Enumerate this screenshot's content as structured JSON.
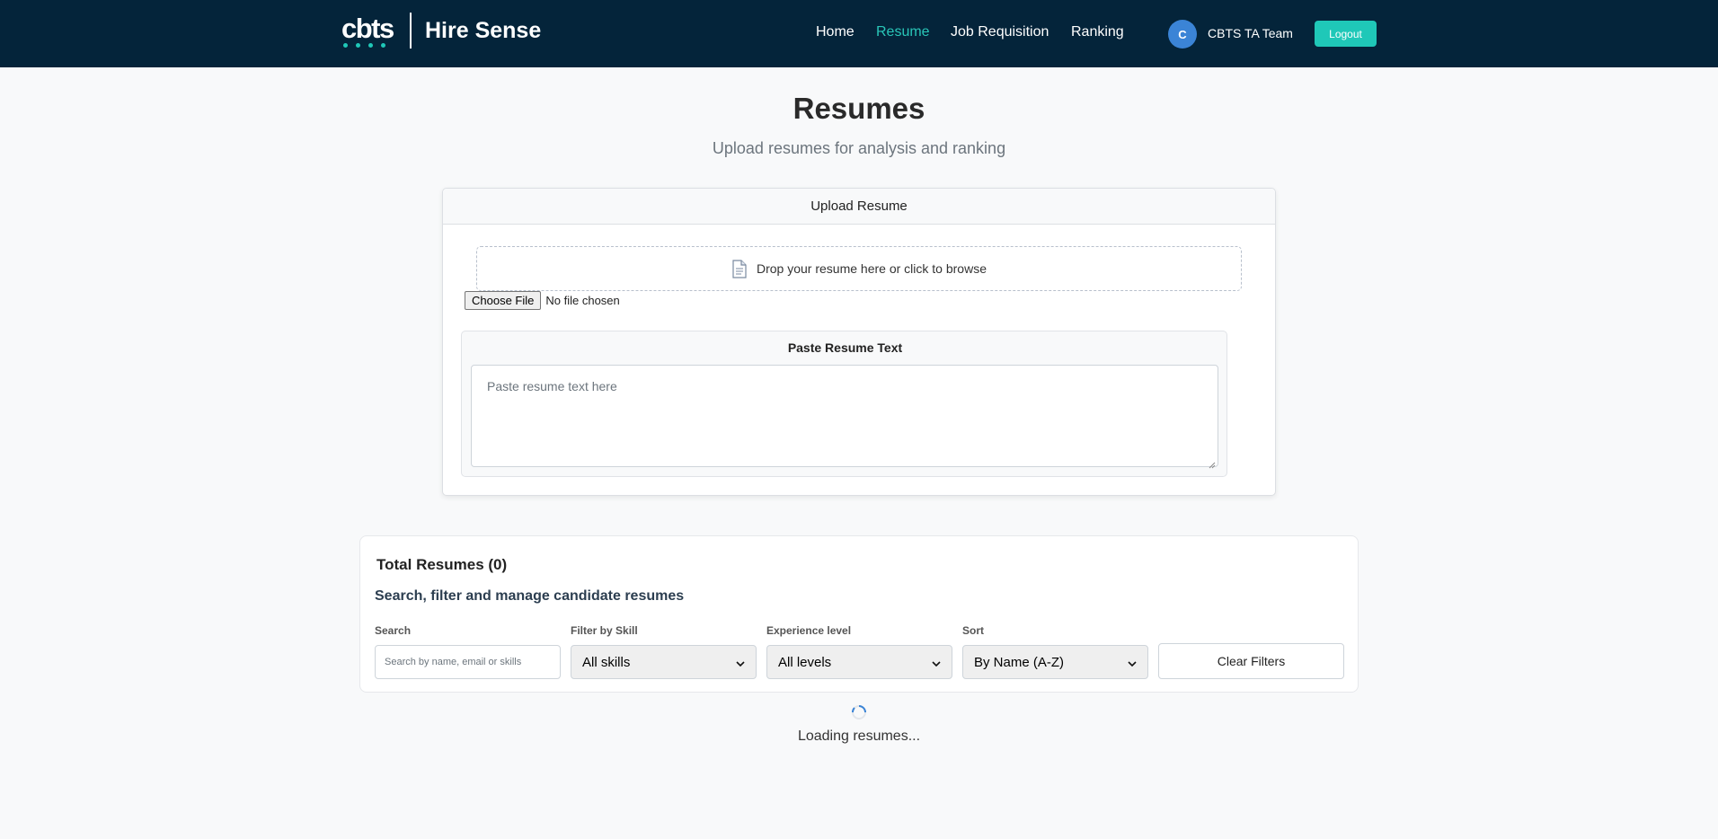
{
  "navbar": {
    "logo_text": "cbts",
    "app_title": "Hire Sense",
    "links": [
      {
        "label": "Home",
        "active": false
      },
      {
        "label": "Resume",
        "active": true
      },
      {
        "label": "Job Requisition",
        "active": false
      },
      {
        "label": "Ranking",
        "active": false
      }
    ],
    "user_initial": "C",
    "user_name": "CBTS TA Team",
    "logout_label": "Logout"
  },
  "header": {
    "title": "Resumes",
    "subtitle": "Upload resumes for analysis and ranking"
  },
  "upload": {
    "card_title": "Upload Resume",
    "dropzone_icon": "document-icon",
    "dropzone_text": "Drop your resume here or click to browse",
    "choose_file_label": "Choose File",
    "file_status": "No file chosen",
    "paste_title": "Paste Resume Text",
    "paste_placeholder": "Paste resume text here"
  },
  "resumes": {
    "total_title": "Total Resumes (0)",
    "manage_title": "Search, filter and manage candidate resumes",
    "search_label": "Search",
    "search_placeholder": "Search by name, email or skills",
    "skill_label": "Filter by Skill",
    "skill_value": "All skills",
    "experience_label": "Experience level",
    "experience_value": "All levels",
    "sort_label": "Sort",
    "sort_value": "By Name (A-Z)",
    "clear_label": "Clear Filters"
  },
  "loading": {
    "text": "Loading resumes..."
  },
  "colors": {
    "navbar_bg": "#04243a",
    "accent": "#1fc8b8",
    "active_link": "#29c6b8",
    "avatar_bg": "#3b84d6"
  }
}
